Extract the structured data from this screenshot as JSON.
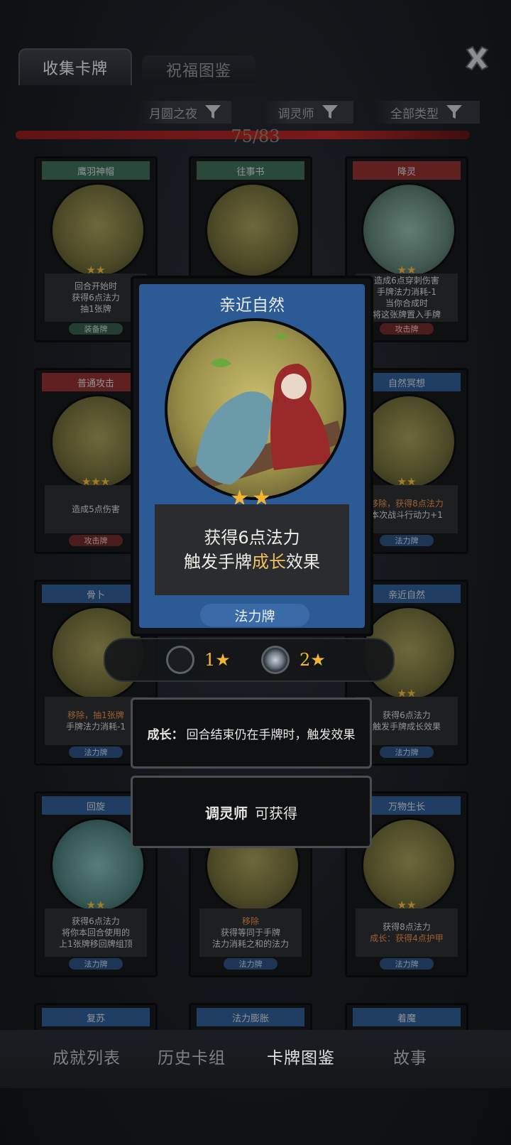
{
  "tabs": {
    "collect": "收集卡牌",
    "bless": "祝福图鉴"
  },
  "filters": {
    "night": "月圆之夜",
    "class": "调灵师",
    "type": "全部类型"
  },
  "progress": {
    "text": "75/83",
    "value": 0.9036
  },
  "cards": [
    {
      "name": "鹰羽神帽",
      "stars": "★★",
      "desc": [
        "回合开始时",
        "获得6点法力",
        "抽1张牌"
      ],
      "type": "装备牌"
    },
    {
      "name": "往事书",
      "stars": "★★",
      "desc": [],
      "type": ""
    },
    {
      "name": "降灵",
      "stars": "★★",
      "desc": [
        "造成6点穿刺伤害",
        "手牌法力消耗-1",
        "当你合成时",
        "将这张牌置入手牌"
      ],
      "type": "攻击牌"
    },
    {
      "name": "普通攻击",
      "stars": "★★★",
      "desc": [
        "造成5点伤害"
      ],
      "type": "攻击牌"
    },
    {
      "name": "自然冥想",
      "stars": "★★",
      "desc": [
        "移除，获得8点法力",
        "本次战斗行动力+1"
      ],
      "type": "法力牌"
    },
    {
      "name": "骨卜",
      "stars": "",
      "desc": [
        "移除，抽1张牌",
        "手牌法力消耗-1"
      ],
      "type": "法力牌"
    },
    {
      "name": "亲近自然",
      "stars": "★★",
      "desc": [
        "获得6点法力",
        "触发手牌成长效果"
      ],
      "type": "法力牌"
    },
    {
      "name": "回旋",
      "stars": "★★",
      "desc": [
        "获得6点法力",
        "将你本回合使用的",
        "上1张牌移回牌组顶"
      ],
      "type": "法力牌"
    },
    {
      "name": "",
      "stars": "",
      "desc": [
        "移除",
        "获得等同于手牌",
        "法力消耗之和的法力"
      ],
      "type": "法力牌"
    },
    {
      "name": "万物生长",
      "stars": "★★",
      "desc": [
        "获得8点法力",
        "成长：获得4点护甲"
      ],
      "type": "法力牌"
    },
    {
      "name": "复苏"
    },
    {
      "name": "法力膨胀"
    },
    {
      "name": "着魔"
    }
  ],
  "detail": {
    "name": "亲近自然",
    "stars": "★★",
    "line1": "获得6点法力",
    "line2_pre": "触发手牌",
    "line2_hl": "成长",
    "line2_post": "效果",
    "type": "法力牌",
    "levels": [
      {
        "num": "1",
        "star": "★"
      },
      {
        "num": "2",
        "star": "★"
      }
    ],
    "growth_label": "成长：",
    "growth_text": "回合结束仍在手牌时，触发效果",
    "obtain_who": "调灵师",
    "obtain_text": "可获得"
  },
  "nav": {
    "achievements": "成就列表",
    "history": "历史卡组",
    "cards": "卡牌图鉴",
    "story": "故事"
  },
  "colors": {
    "accent_gold": "#f1b632",
    "progress_red": "#b12626",
    "card_blue": "#2f5a8e",
    "card_green": "#3c6a55",
    "card_red": "#8a2e2e"
  }
}
